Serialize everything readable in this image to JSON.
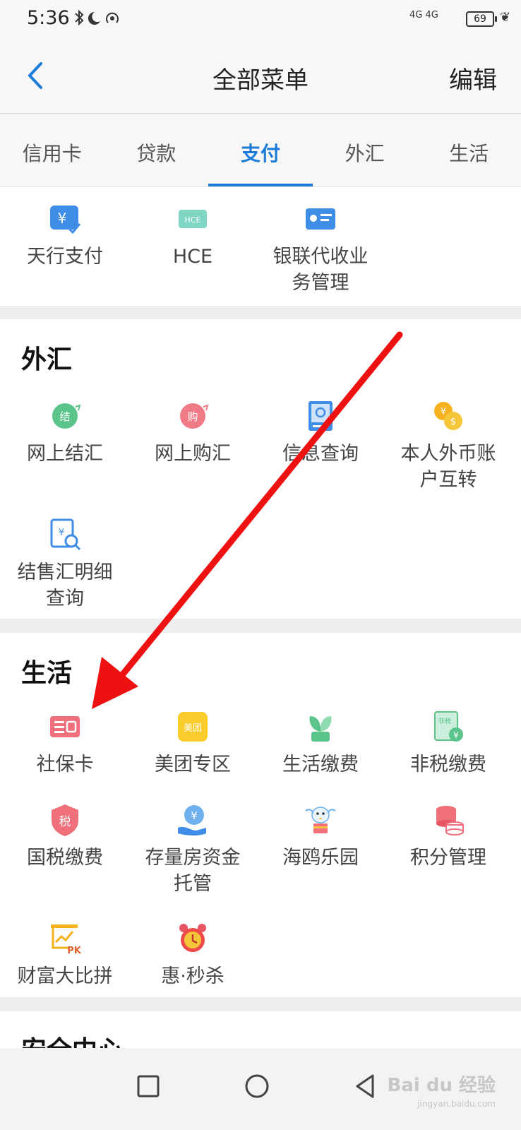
{
  "status": {
    "time": "5:36",
    "signal": "4G 4G",
    "battery": "69"
  },
  "header": {
    "title": "全部菜单",
    "edit": "编辑"
  },
  "tabs": [
    {
      "label": "信用卡"
    },
    {
      "label": "贷款"
    },
    {
      "label": "支付"
    },
    {
      "label": "外汇"
    },
    {
      "label": "生活"
    }
  ],
  "payment": {
    "items": [
      {
        "label": "天行支付",
        "icon": "yuan-check-icon"
      },
      {
        "label": "HCE",
        "icon": "hce-card-icon"
      },
      {
        "label": "银联代收业务管理",
        "icon": "id-card-icon"
      }
    ]
  },
  "forex": {
    "title": "外汇",
    "items": [
      {
        "label": "网上结汇",
        "icon": "settle-icon"
      },
      {
        "label": "网上购汇",
        "icon": "purchase-icon"
      },
      {
        "label": "信息查询",
        "icon": "info-query-icon"
      },
      {
        "label": "本人外币账户互转",
        "icon": "coins-transfer-icon"
      },
      {
        "label": "结售汇明细查询",
        "icon": "detail-query-icon"
      }
    ]
  },
  "life": {
    "title": "生活",
    "items": [
      {
        "label": "社保卡",
        "icon": "social-card-icon"
      },
      {
        "label": "美团专区",
        "icon": "meituan-icon"
      },
      {
        "label": "生活缴费",
        "icon": "plant-icon"
      },
      {
        "label": "非税缴费",
        "icon": "non-tax-icon"
      },
      {
        "label": "国税缴费",
        "icon": "tax-shield-icon"
      },
      {
        "label": "存量房资金托管",
        "icon": "hand-yuan-icon"
      },
      {
        "label": "海鸥乐园",
        "icon": "seagull-icon"
      },
      {
        "label": "积分管理",
        "icon": "coins-stack-icon"
      },
      {
        "label": "财富大比拼",
        "icon": "pk-chart-icon"
      },
      {
        "label": "惠·秒杀",
        "icon": "alarm-clock-icon"
      }
    ]
  },
  "security": {
    "title": "安全中心"
  },
  "watermark": {
    "main": "Bai du 经验",
    "sub": "jingyan.baidu.com"
  },
  "colors": {
    "accent": "#1a7bd8",
    "arrow": "#ee1111"
  }
}
